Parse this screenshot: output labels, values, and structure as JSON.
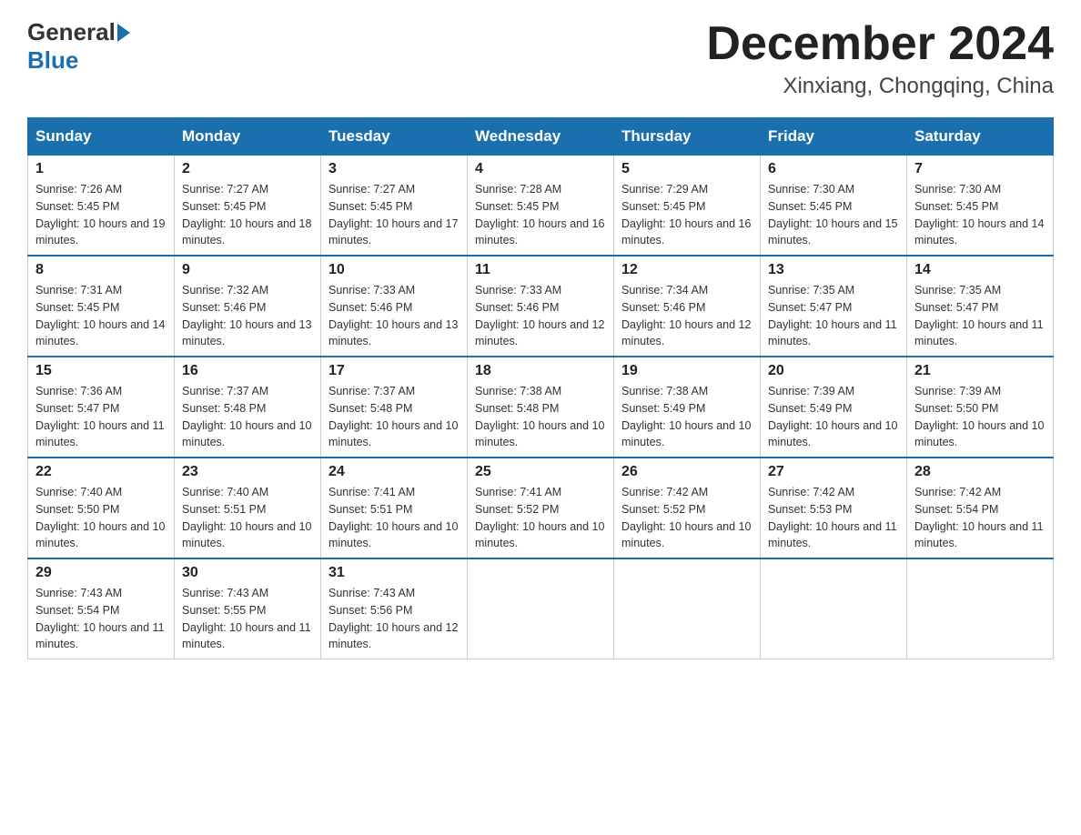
{
  "logo": {
    "general": "General",
    "blue": "Blue"
  },
  "title": "December 2024",
  "subtitle": "Xinxiang, Chongqing, China",
  "days_of_week": [
    "Sunday",
    "Monday",
    "Tuesday",
    "Wednesday",
    "Thursday",
    "Friday",
    "Saturday"
  ],
  "weeks": [
    [
      {
        "day": "1",
        "sunrise": "7:26 AM",
        "sunset": "5:45 PM",
        "daylight": "10 hours and 19 minutes."
      },
      {
        "day": "2",
        "sunrise": "7:27 AM",
        "sunset": "5:45 PM",
        "daylight": "10 hours and 18 minutes."
      },
      {
        "day": "3",
        "sunrise": "7:27 AM",
        "sunset": "5:45 PM",
        "daylight": "10 hours and 17 minutes."
      },
      {
        "day": "4",
        "sunrise": "7:28 AM",
        "sunset": "5:45 PM",
        "daylight": "10 hours and 16 minutes."
      },
      {
        "day": "5",
        "sunrise": "7:29 AM",
        "sunset": "5:45 PM",
        "daylight": "10 hours and 16 minutes."
      },
      {
        "day": "6",
        "sunrise": "7:30 AM",
        "sunset": "5:45 PM",
        "daylight": "10 hours and 15 minutes."
      },
      {
        "day": "7",
        "sunrise": "7:30 AM",
        "sunset": "5:45 PM",
        "daylight": "10 hours and 14 minutes."
      }
    ],
    [
      {
        "day": "8",
        "sunrise": "7:31 AM",
        "sunset": "5:45 PM",
        "daylight": "10 hours and 14 minutes."
      },
      {
        "day": "9",
        "sunrise": "7:32 AM",
        "sunset": "5:46 PM",
        "daylight": "10 hours and 13 minutes."
      },
      {
        "day": "10",
        "sunrise": "7:33 AM",
        "sunset": "5:46 PM",
        "daylight": "10 hours and 13 minutes."
      },
      {
        "day": "11",
        "sunrise": "7:33 AM",
        "sunset": "5:46 PM",
        "daylight": "10 hours and 12 minutes."
      },
      {
        "day": "12",
        "sunrise": "7:34 AM",
        "sunset": "5:46 PM",
        "daylight": "10 hours and 12 minutes."
      },
      {
        "day": "13",
        "sunrise": "7:35 AM",
        "sunset": "5:47 PM",
        "daylight": "10 hours and 11 minutes."
      },
      {
        "day": "14",
        "sunrise": "7:35 AM",
        "sunset": "5:47 PM",
        "daylight": "10 hours and 11 minutes."
      }
    ],
    [
      {
        "day": "15",
        "sunrise": "7:36 AM",
        "sunset": "5:47 PM",
        "daylight": "10 hours and 11 minutes."
      },
      {
        "day": "16",
        "sunrise": "7:37 AM",
        "sunset": "5:48 PM",
        "daylight": "10 hours and 10 minutes."
      },
      {
        "day": "17",
        "sunrise": "7:37 AM",
        "sunset": "5:48 PM",
        "daylight": "10 hours and 10 minutes."
      },
      {
        "day": "18",
        "sunrise": "7:38 AM",
        "sunset": "5:48 PM",
        "daylight": "10 hours and 10 minutes."
      },
      {
        "day": "19",
        "sunrise": "7:38 AM",
        "sunset": "5:49 PM",
        "daylight": "10 hours and 10 minutes."
      },
      {
        "day": "20",
        "sunrise": "7:39 AM",
        "sunset": "5:49 PM",
        "daylight": "10 hours and 10 minutes."
      },
      {
        "day": "21",
        "sunrise": "7:39 AM",
        "sunset": "5:50 PM",
        "daylight": "10 hours and 10 minutes."
      }
    ],
    [
      {
        "day": "22",
        "sunrise": "7:40 AM",
        "sunset": "5:50 PM",
        "daylight": "10 hours and 10 minutes."
      },
      {
        "day": "23",
        "sunrise": "7:40 AM",
        "sunset": "5:51 PM",
        "daylight": "10 hours and 10 minutes."
      },
      {
        "day": "24",
        "sunrise": "7:41 AM",
        "sunset": "5:51 PM",
        "daylight": "10 hours and 10 minutes."
      },
      {
        "day": "25",
        "sunrise": "7:41 AM",
        "sunset": "5:52 PM",
        "daylight": "10 hours and 10 minutes."
      },
      {
        "day": "26",
        "sunrise": "7:42 AM",
        "sunset": "5:52 PM",
        "daylight": "10 hours and 10 minutes."
      },
      {
        "day": "27",
        "sunrise": "7:42 AM",
        "sunset": "5:53 PM",
        "daylight": "10 hours and 11 minutes."
      },
      {
        "day": "28",
        "sunrise": "7:42 AM",
        "sunset": "5:54 PM",
        "daylight": "10 hours and 11 minutes."
      }
    ],
    [
      {
        "day": "29",
        "sunrise": "7:43 AM",
        "sunset": "5:54 PM",
        "daylight": "10 hours and 11 minutes."
      },
      {
        "day": "30",
        "sunrise": "7:43 AM",
        "sunset": "5:55 PM",
        "daylight": "10 hours and 11 minutes."
      },
      {
        "day": "31",
        "sunrise": "7:43 AM",
        "sunset": "5:56 PM",
        "daylight": "10 hours and 12 minutes."
      },
      null,
      null,
      null,
      null
    ]
  ],
  "labels": {
    "sunrise": "Sunrise:",
    "sunset": "Sunset:",
    "daylight": "Daylight:"
  }
}
